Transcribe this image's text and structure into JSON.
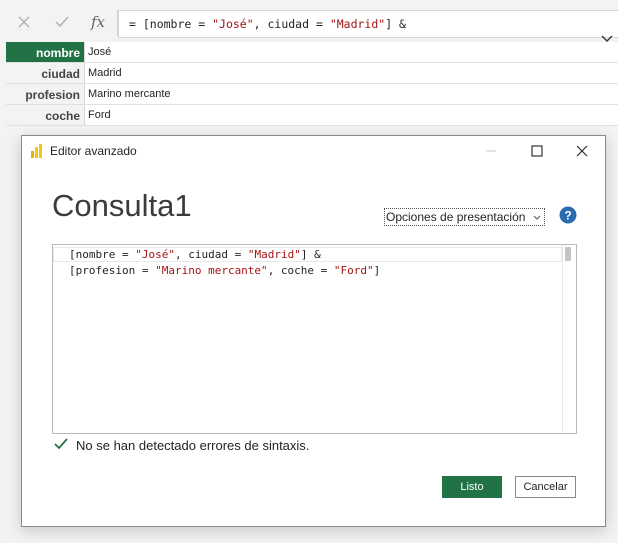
{
  "formula_bar": {
    "cancel_icon": "close-icon",
    "commit_icon": "checkmark-icon",
    "fx_label": "fx",
    "formula_prefix": "= [nombre = ",
    "formula_str1": "\"José\"",
    "formula_mid": ", ciudad = ",
    "formula_str2": "\"Madrid\"",
    "formula_suffix": "] &"
  },
  "record": {
    "rows": [
      {
        "key": "nombre",
        "value": "José"
      },
      {
        "key": "ciudad",
        "value": "Madrid"
      },
      {
        "key": "profesion",
        "value": "Marino mercante"
      },
      {
        "key": "coche",
        "value": "Ford"
      }
    ]
  },
  "dialog": {
    "title": "Editor avanzado",
    "query_name": "Consulta1",
    "view_options": "Opciones de presentación",
    "code": {
      "l1_a": "[nombre = ",
      "l1_b": "\"José\"",
      "l1_c": ", ciudad = ",
      "l1_d": "\"Madrid\"",
      "l1_e": "] &",
      "l2_a": "[profesion = ",
      "l2_b": "\"Marino mercante\"",
      "l2_c": ", coche = ",
      "l2_d": "\"Ford\"",
      "l2_e": "]"
    },
    "status_text": "No se han detectado errores de sintaxis.",
    "ok_label": "Listo",
    "cancel_label": "Cancelar"
  },
  "colors": {
    "accent": "#217346",
    "string": "#a31515",
    "help": "#2b6cb0"
  }
}
